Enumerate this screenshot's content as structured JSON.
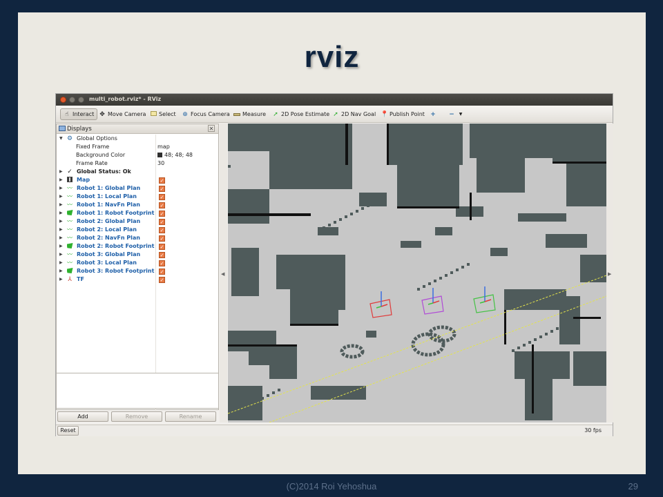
{
  "slide": {
    "title": "rviz",
    "footer": "(C)2014 Roi Yehoshua",
    "page_number": "29"
  },
  "window": {
    "title": "multi_robot.rviz* - RViz"
  },
  "toolbar": {
    "tools": [
      {
        "label": "Interact",
        "icon": "hand-pointer-icon",
        "active": true
      },
      {
        "label": "Move Camera",
        "icon": "move-camera-icon",
        "active": false
      },
      {
        "label": "Select",
        "icon": "select-icon",
        "active": false
      },
      {
        "label": "Focus Camera",
        "icon": "focus-camera-icon",
        "active": false
      },
      {
        "label": "Measure",
        "icon": "ruler-icon",
        "active": false
      },
      {
        "label": "2D Pose Estimate",
        "icon": "pose-arrow-icon",
        "active": false
      },
      {
        "label": "2D Nav Goal",
        "icon": "nav-goal-arrow-icon",
        "active": false
      },
      {
        "label": "Publish Point",
        "icon": "map-pin-icon",
        "active": false
      }
    ]
  },
  "displays": {
    "title": "Displays",
    "global_options": {
      "label": "Global Options",
      "fixed_frame_label": "Fixed Frame",
      "fixed_frame_value": "map",
      "background_color_label": "Background Color",
      "background_color_value": "48; 48; 48",
      "background_color_hex": "#303030",
      "frame_rate_label": "Frame Rate",
      "frame_rate_value": "30"
    },
    "global_status": "Global Status: Ok",
    "items": [
      {
        "label": "Map",
        "icon": "map-icon",
        "checked": true
      },
      {
        "label": "Robot 1: Global Plan",
        "icon": "path-icon",
        "checked": true
      },
      {
        "label": "Robot 1: Local Plan",
        "icon": "path-icon",
        "checked": true
      },
      {
        "label": "Robot 1: NavFn Plan",
        "icon": "path-icon",
        "checked": true
      },
      {
        "label": "Robot 1: Robot Footprint",
        "icon": "polygon-icon",
        "checked": true
      },
      {
        "label": "Robot 2: Global Plan",
        "icon": "path-icon",
        "checked": true
      },
      {
        "label": "Robot 2: Local Plan",
        "icon": "path-icon",
        "checked": true
      },
      {
        "label": "Robot 2: NavFn Plan",
        "icon": "path-icon",
        "checked": true
      },
      {
        "label": "Robot 2: Robot Footprint",
        "icon": "polygon-icon",
        "checked": true
      },
      {
        "label": "Robot 3: Global Plan",
        "icon": "path-icon",
        "checked": true
      },
      {
        "label": "Robot 3: Local Plan",
        "icon": "path-icon",
        "checked": true
      },
      {
        "label": "Robot 3: Robot Footprint",
        "icon": "polygon-icon",
        "checked": true
      },
      {
        "label": "TF",
        "icon": "tf-axes-icon",
        "checked": true
      }
    ]
  },
  "buttons": {
    "add": "Add",
    "remove": "Remove",
    "rename": "Rename",
    "reset": "Reset"
  },
  "status": {
    "fps": "30 fps"
  },
  "colors": {
    "map_free": "#c7c7c7",
    "map_occupied": "#4f5b5b",
    "map_wall": "#111111",
    "robot1_footprint": "#e03a3a",
    "robot2_footprint": "#b04ad6",
    "robot3_footprint": "#44c244",
    "plan_line": "#e4e44a"
  }
}
